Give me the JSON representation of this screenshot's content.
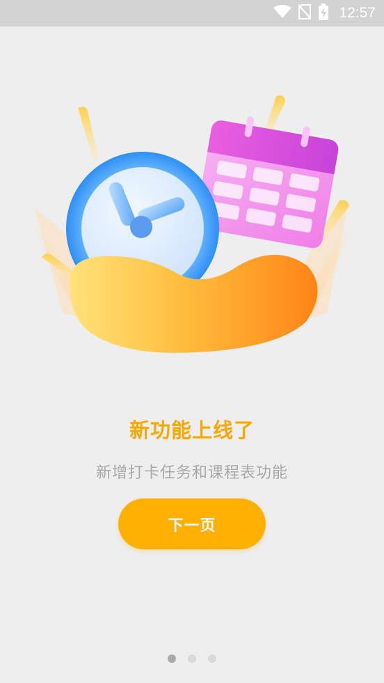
{
  "status_bar": {
    "time": "12:57",
    "icons": [
      "wifi-icon",
      "no-sim-icon",
      "battery-charging-icon"
    ]
  },
  "illustration": {
    "icons": [
      "clock-icon",
      "calendar-icon"
    ]
  },
  "onboarding": {
    "title": "新功能上线了",
    "subtitle": "新增打卡任务和课程表功能",
    "next_button_label": "下一页"
  },
  "pagination": {
    "total_pages": 3,
    "current_page": 1
  },
  "colors": {
    "accent": "#ffb000",
    "title": "#f5a800",
    "subtitle": "#a8a8a8",
    "background": "#eeeeee",
    "status_bar": "#d2d2d2"
  }
}
